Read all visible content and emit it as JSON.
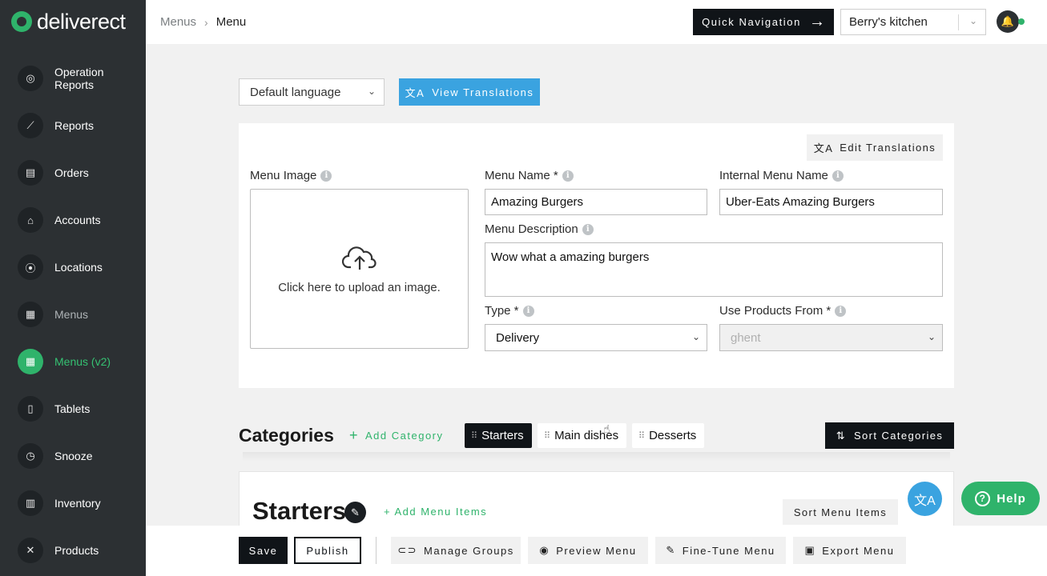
{
  "brand": {
    "name": "deliverect"
  },
  "sidebar": {
    "items": [
      {
        "label": "Operation Reports",
        "icon": "compass-icon"
      },
      {
        "label": "Reports",
        "icon": "chart-icon"
      },
      {
        "label": "Orders",
        "icon": "receipt-icon"
      },
      {
        "label": "Accounts",
        "icon": "bank-icon"
      },
      {
        "label": "Locations",
        "icon": "pin-icon"
      },
      {
        "label": "Menus",
        "icon": "menu-book-icon"
      },
      {
        "label": "Menus (v2)",
        "icon": "menu-book-icon"
      },
      {
        "label": "Tablets",
        "icon": "tablet-icon"
      },
      {
        "label": "Snooze",
        "icon": "alarm-icon"
      },
      {
        "label": "Inventory",
        "icon": "clipboard-icon"
      },
      {
        "label": "Products",
        "icon": "utensils-icon"
      }
    ]
  },
  "header": {
    "breadcrumb": {
      "parent": "Menus",
      "current": "Menu"
    },
    "quick_nav_label": "Quick Navigation",
    "account": "Berry's kitchen"
  },
  "language": {
    "selected": "Default language",
    "view_translations": "View Translations"
  },
  "menu_form": {
    "edit_translations": "Edit Translations",
    "image_label": "Menu Image",
    "upload_text": "Click here to upload an image.",
    "name_label": "Menu Name *",
    "name_value": "Amazing Burgers",
    "internal_label": "Internal Menu Name",
    "internal_value": "Uber-Eats Amazing Burgers",
    "description_label": "Menu Description",
    "description_value": "Wow what a amazing burgers",
    "type_label": "Type *",
    "type_value": "Delivery",
    "products_label": "Use Products From *",
    "products_value": "ghent"
  },
  "categories": {
    "title": "Categories",
    "add_label": "Add Category",
    "tabs": [
      "Starters",
      "Main dishes",
      "Desserts"
    ],
    "sort_label": "Sort Categories"
  },
  "section": {
    "title": "Starters",
    "add_items": "+ Add Menu Items",
    "sort_items": "Sort Menu Items"
  },
  "help_label": "Help",
  "toolbar": {
    "save": "Save",
    "publish": "Publish",
    "manage_groups": "Manage Groups",
    "preview_menu": "Preview Menu",
    "fine_tune": "Fine-Tune Menu",
    "export_menu": "Export Menu"
  },
  "colors": {
    "brand_green": "#2fb36b",
    "accent_blue": "#3aa3e0",
    "sidebar_bg": "#2c3033",
    "dark_button": "#101418"
  }
}
